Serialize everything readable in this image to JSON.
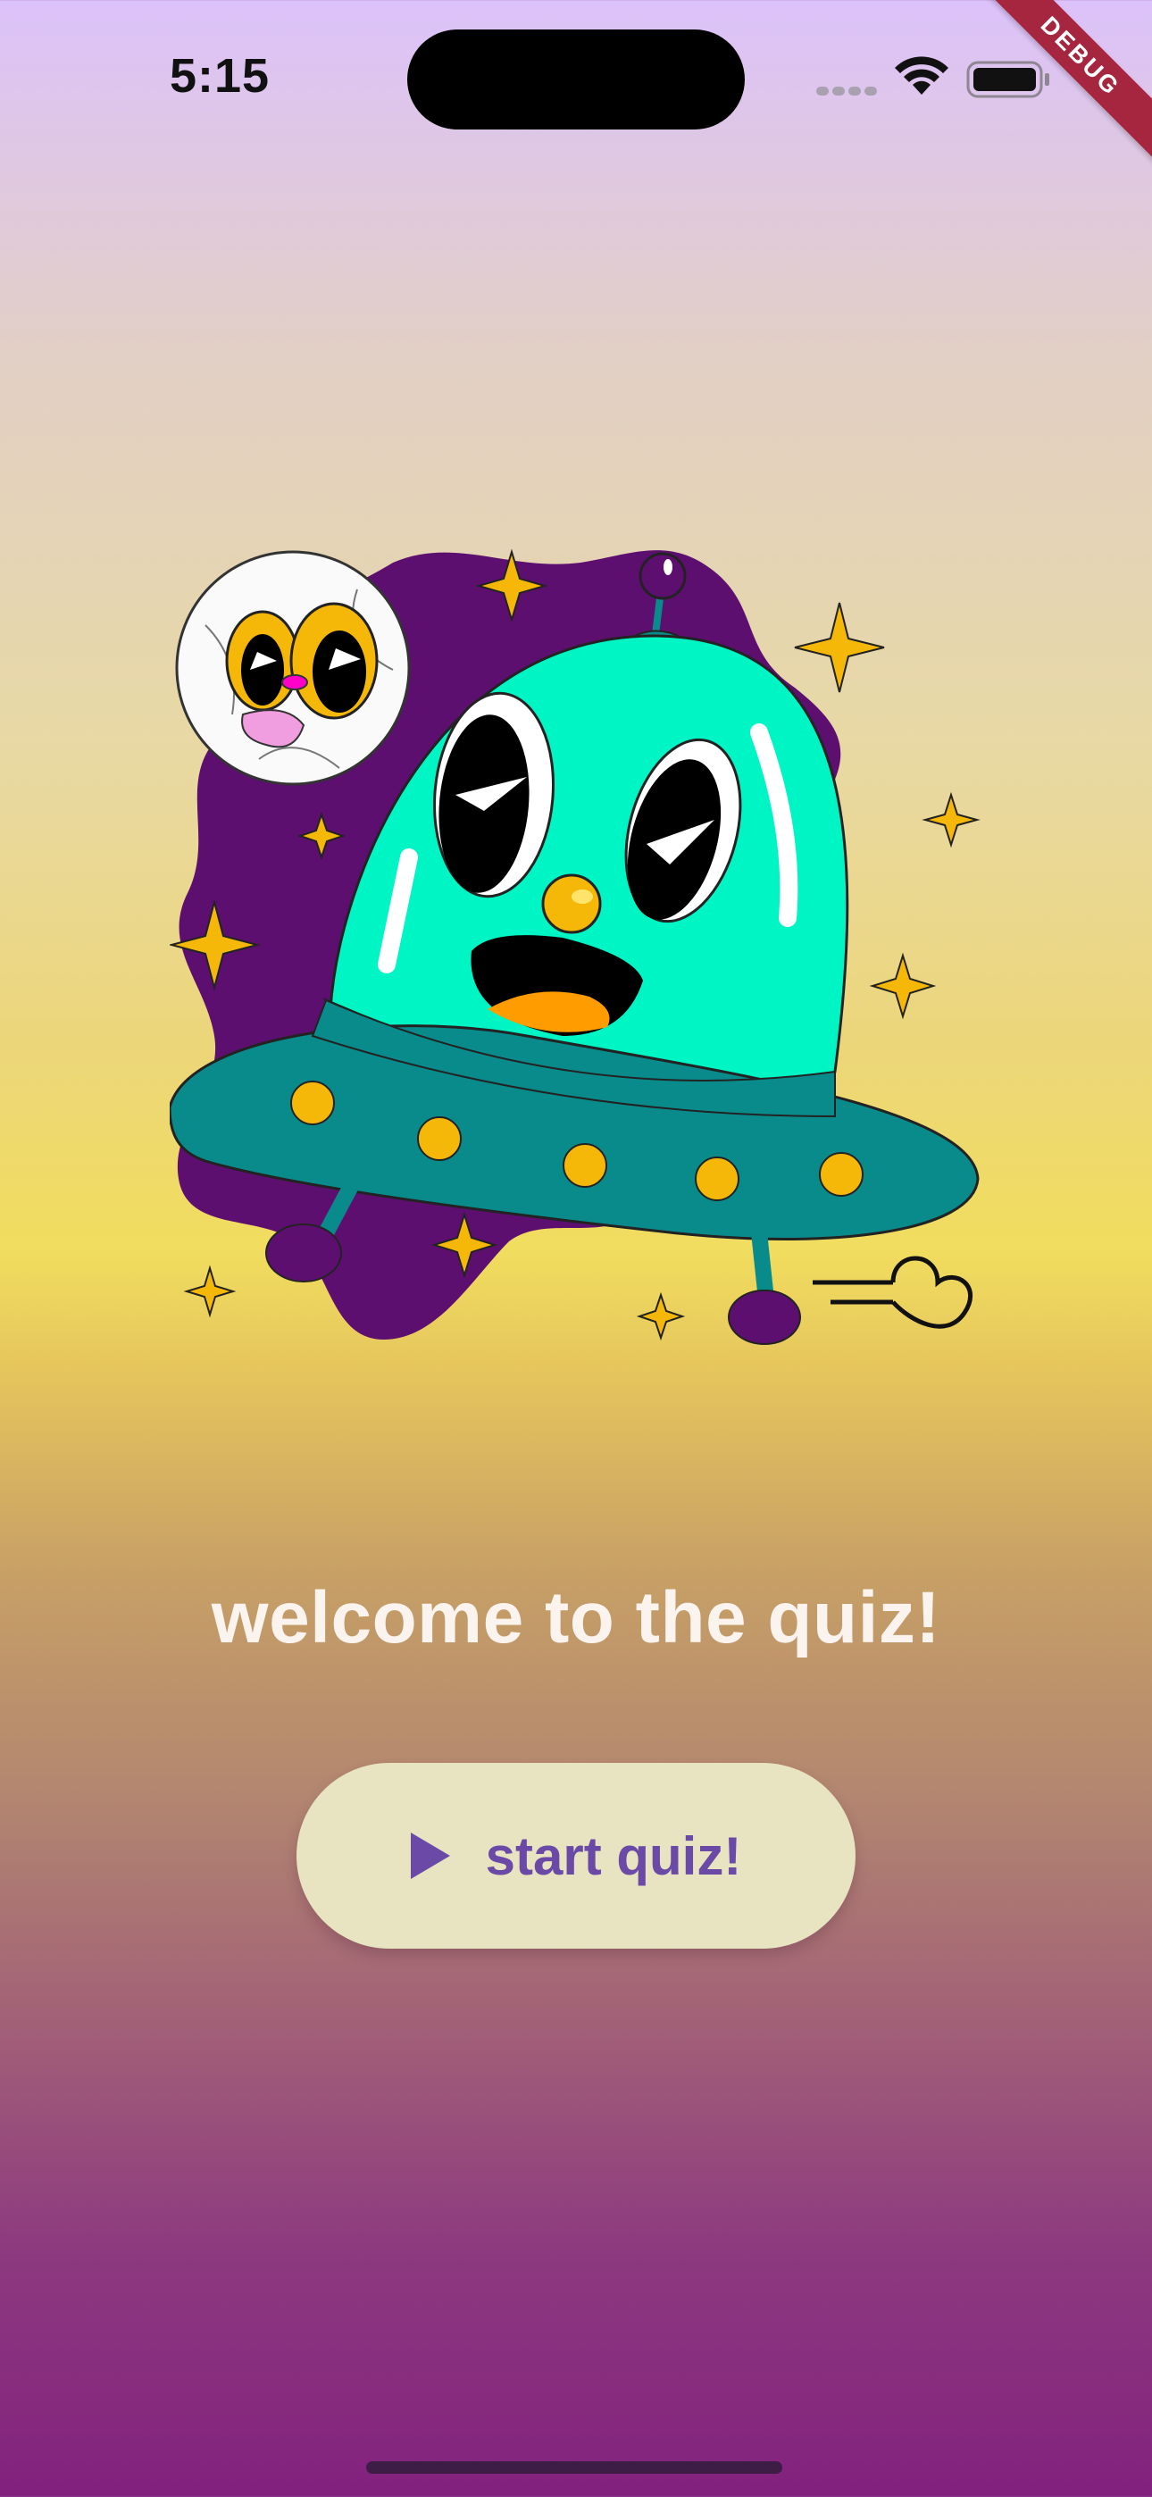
{
  "status_bar": {
    "time": "5:15",
    "icons": [
      "cellular-signal-icon",
      "wifi-icon",
      "battery-icon"
    ]
  },
  "debug_banner": {
    "label": "DEBUG"
  },
  "illustration": {
    "name": "alien-ufo-illustration"
  },
  "main": {
    "title": "welcome to the quiz!",
    "start_button": {
      "label": "start quiz!",
      "icon": "play-icon"
    }
  },
  "colors": {
    "button_bg": "#e8e3c1",
    "button_text": "#6a4aa6",
    "title_text": "#fbf4ee",
    "debug_banner": "#a6263f",
    "ufo_dome": "#00f5c4",
    "ufo_base": "#0a8b8b",
    "blob": "#5d0f70",
    "star": "#f5b808"
  }
}
